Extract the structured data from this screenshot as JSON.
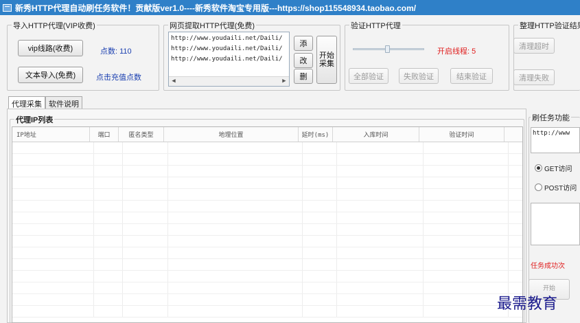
{
  "window": {
    "title": "新秀HTTP代理自动刷任务软件！贡献版ver1.0----新秀软件淘宝专用版---https://shop115548934.taobao.com/",
    "icon": "app-window-icon"
  },
  "import_group": {
    "title": "导入HTTP代理(VIP收费)",
    "vip_button": "vip线路(收费)",
    "points_label": "点数: 110",
    "text_import_button": "文本导入(免费)",
    "recharge_link": "点击充值点数"
  },
  "fetch_group": {
    "title": "网页提取HTTP代理(免费)",
    "urls": [
      "http://www.youdaili.net/Daili/",
      "http://www.youdaili.net/Daili/",
      "http://www.youdaili.net/Daili/"
    ],
    "add_button": "添",
    "edit_button": "改",
    "delete_button": "删",
    "start_collect_button": [
      "开始",
      "采集"
    ]
  },
  "verify_group": {
    "title": "验证HTTP代理",
    "threads_label": "开启线程: 5",
    "verify_all_button": "全部验证",
    "verify_failed_button": "失败验证",
    "end_verify_button": "结束验证"
  },
  "organize_group": {
    "title": "整理HTTP验证结果",
    "clear_timeout_button": "清理超时",
    "clear_failed_button": "清理失败"
  },
  "tabs": [
    {
      "label": "代理采集",
      "active": true
    },
    {
      "label": "软件说明",
      "active": false
    }
  ],
  "proxy_list": {
    "title": "代理IP列表",
    "columns": [
      "IP地址",
      "端口",
      "匿名类型",
      "地理位置",
      "延时(ms)",
      "入库时间",
      "验证时间"
    ],
    "rows": []
  },
  "task_panel": {
    "title": "刷任务功能",
    "url_value": "http://www",
    "get_label": "GET访问",
    "post_label": "POST访问",
    "success_label": "任务成功次",
    "start_button": "开始"
  },
  "watermark": "最需教育",
  "colors": {
    "title_bar": "#2f80c8",
    "accent_blue": "#1a3fb0",
    "accent_red": "#e02020"
  }
}
